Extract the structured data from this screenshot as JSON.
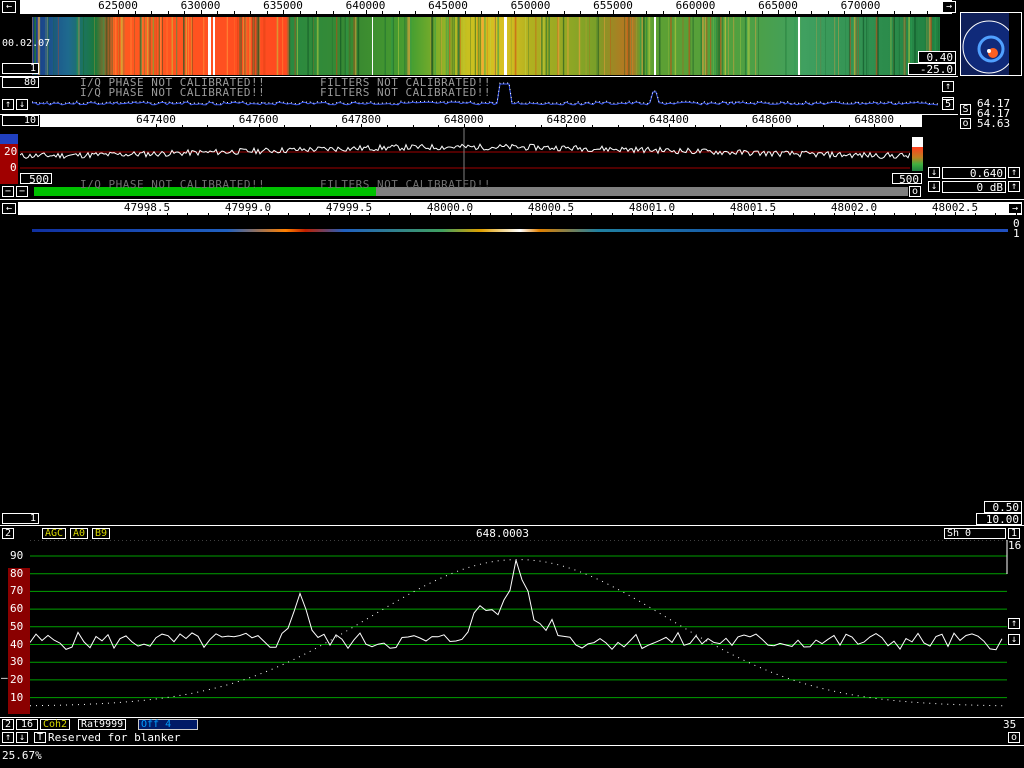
{
  "waterfall_top": {
    "time": "00.02.07",
    "freq_labels": [
      "625000",
      "630000",
      "635000",
      "640000",
      "645000",
      "650000",
      "655000",
      "660000",
      "665000",
      "670000"
    ],
    "left_box": "1",
    "right_val_a": "0.40",
    "right_val_b": "-25.0"
  },
  "spectrum_top": {
    "left_box": "80",
    "warnings": [
      "I/Q PHASE NOT CALIBRATED!!",
      "FILTERS NOT CALIBRATED!!"
    ]
  },
  "side_readout": {
    "s_label": "S",
    "o_label": "o",
    "s1": "64.17",
    "s2": "64.17",
    "o1": "54.63",
    "right_icon_label": "5"
  },
  "zoom_panel": {
    "left_box": "10",
    "freq_labels": [
      "647400",
      "647600",
      "647800",
      "648000",
      "648200",
      "648400",
      "648600",
      "648800"
    ],
    "y_labels": [
      "20",
      "0"
    ],
    "box_left": "500",
    "box_right": "500",
    "gain_val": "0.640",
    "db_val": "0 dB",
    "warnings": [
      "I/Q PHASE NOT CALIBRATED!!",
      "FILTERS NOT CALIBRATED!!"
    ],
    "o_label": "o"
  },
  "baseband_panel": {
    "freq_labels": [
      "47998.5",
      "47999.0",
      "47999.5",
      "48000.0",
      "48000.5",
      "48001.0",
      "48001.5",
      "48002.0",
      "48002.5"
    ],
    "right_labels": [
      "0",
      "1"
    ],
    "left_box": "1",
    "val_a": "0.50",
    "val_b": "10.00"
  },
  "audio_panel": {
    "left_box": "2",
    "agc": "AGC",
    "a0": "A0",
    "b9": "B9",
    "center_freq": "648.0003",
    "sh_label": "Sh 0",
    "right_box": "1",
    "right_num": "16",
    "y_labels": [
      "90",
      "80",
      "70",
      "60",
      "50",
      "40",
      "30",
      "20",
      "10"
    ],
    "bottom_left_a": "2",
    "bottom_left_b": "16",
    "coh": "Coh2",
    "rat": "Rat9999",
    "off": "Off  4",
    "right_bottom": "35",
    "t_label": "T",
    "status": "Reserved for blanker",
    "o_label": "o"
  },
  "footer": {
    "cpu": "25.67%"
  },
  "colors": {
    "green": "#00c000",
    "grid": "#00a000",
    "gray": "#808080",
    "red_bar": "#8a0000"
  }
}
